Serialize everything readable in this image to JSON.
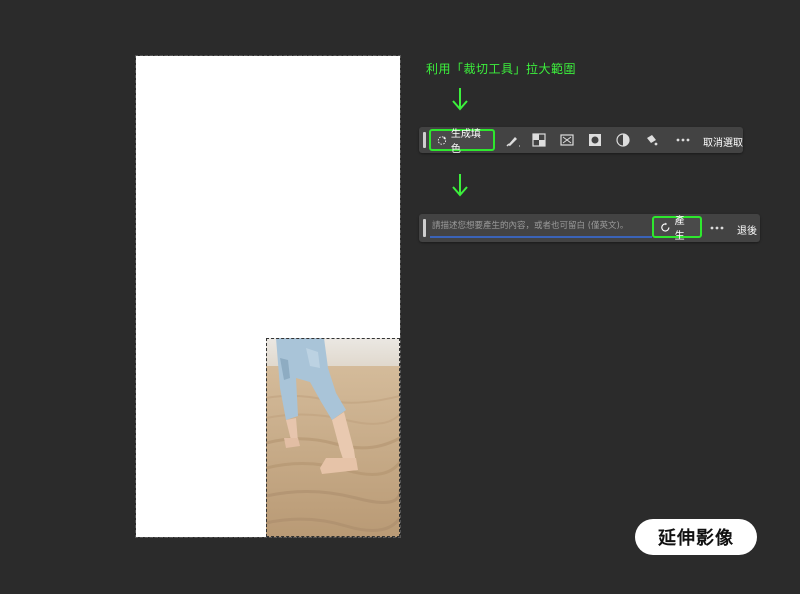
{
  "annotation": {
    "text": "利用「裁切工具」拉大範圍"
  },
  "toolbar_top": {
    "generative_fill_label": "生成填色",
    "deselect_label": "取消選取",
    "icons": [
      "sparkle-icon",
      "brush-icon",
      "mask-invert-icon",
      "transform-icon",
      "circle-mask-icon",
      "adjust-icon",
      "fill-bucket-icon",
      "more-icon"
    ]
  },
  "toolbar_prompt": {
    "placeholder": "請描述您想要產生的內容，或者也可留白 (僅英文)。",
    "generate_label": "產生",
    "back_label": "退後"
  },
  "badge": {
    "label": "延伸影像"
  },
  "colors": {
    "highlight": "#2ee82e",
    "annotation": "#3cf03c",
    "background": "#2b2b2b"
  }
}
